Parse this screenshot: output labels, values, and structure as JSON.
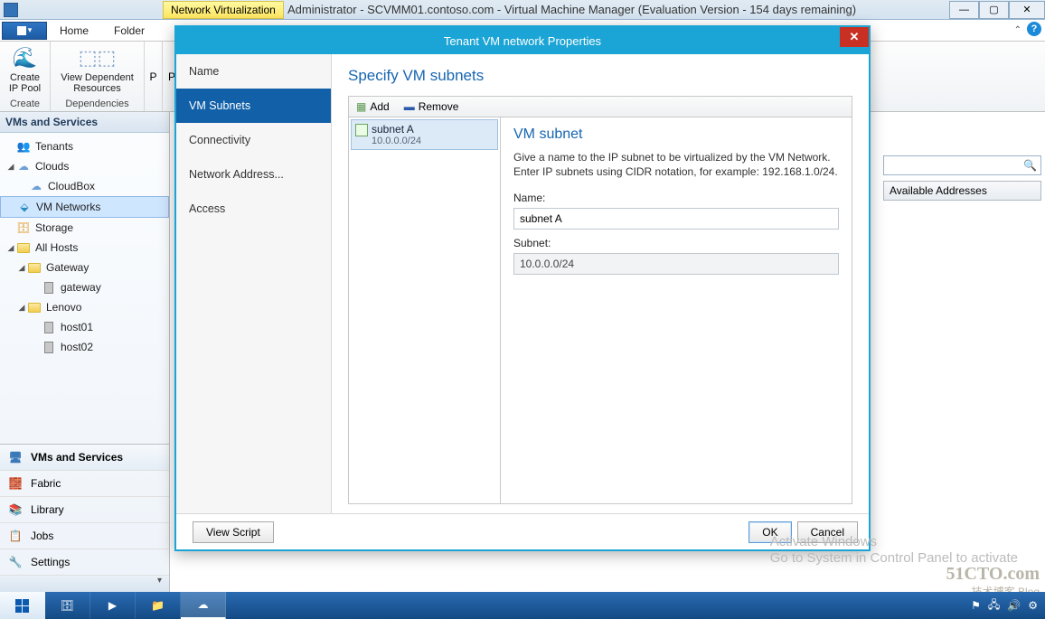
{
  "titlebar": {
    "badge": "Network Virtualization",
    "title": "Administrator - SCVMM01.contoso.com - Virtual Machine Manager (Evaluation Version - 154 days remaining)"
  },
  "menu": {
    "home": "Home",
    "folder": "Folder"
  },
  "ribbon": {
    "create_ip": "Create\nIP Pool",
    "create_foot": "Create",
    "dep_res": "View Dependent\nResources",
    "dep_foot": "Dependencies",
    "pl1": "P",
    "pl2": "P"
  },
  "leftnav": {
    "header": "VMs and Services",
    "tenants": "Tenants",
    "clouds": "Clouds",
    "cloudbox": "CloudBox",
    "vm_networks": "VM Networks",
    "storage": "Storage",
    "all_hosts": "All Hosts",
    "gateway_grp": "Gateway",
    "gateway_host": "gateway",
    "lenovo": "Lenovo",
    "host01": "host01",
    "host02": "host02"
  },
  "bottomnav": {
    "vms": "VMs and Services",
    "fabric": "Fabric",
    "library": "Library",
    "jobs": "Jobs",
    "settings": "Settings"
  },
  "mainpane": {
    "col_avail": "Available Addresses"
  },
  "dialog": {
    "title": "Tenant VM network Properties",
    "nav": {
      "name": "Name",
      "subnets": "VM Subnets",
      "conn": "Connectivity",
      "netaddr": "Network Address...",
      "access": "Access"
    },
    "heading": "Specify VM subnets",
    "toolbar": {
      "add": "Add",
      "remove": "Remove"
    },
    "subnet_list": {
      "0": {
        "name": "subnet A",
        "cidr": "10.0.0.0/24"
      }
    },
    "detail": {
      "title": "VM subnet",
      "desc": "Give a name to the IP subnet to be virtualized by the VM Network. Enter IP subnets using CIDR notation, for example: 192.168.1.0/24.",
      "name_label": "Name:",
      "name_value": "subnet A",
      "subnet_label": "Subnet:",
      "subnet_value": "10.0.0.0/24"
    },
    "footer": {
      "view_script": "View Script",
      "ok": "OK",
      "cancel": "Cancel"
    }
  },
  "watermark": {
    "l1": "Activate Windows",
    "l2": "Go to System in Control Panel to activate"
  },
  "blog": {
    "l1": "51CTO.com",
    "l2": "技术博客  Blog"
  },
  "tray": {
    "flag": "⚑",
    "net": "🖧",
    "snd": "🔊",
    "gear": "⚙"
  }
}
